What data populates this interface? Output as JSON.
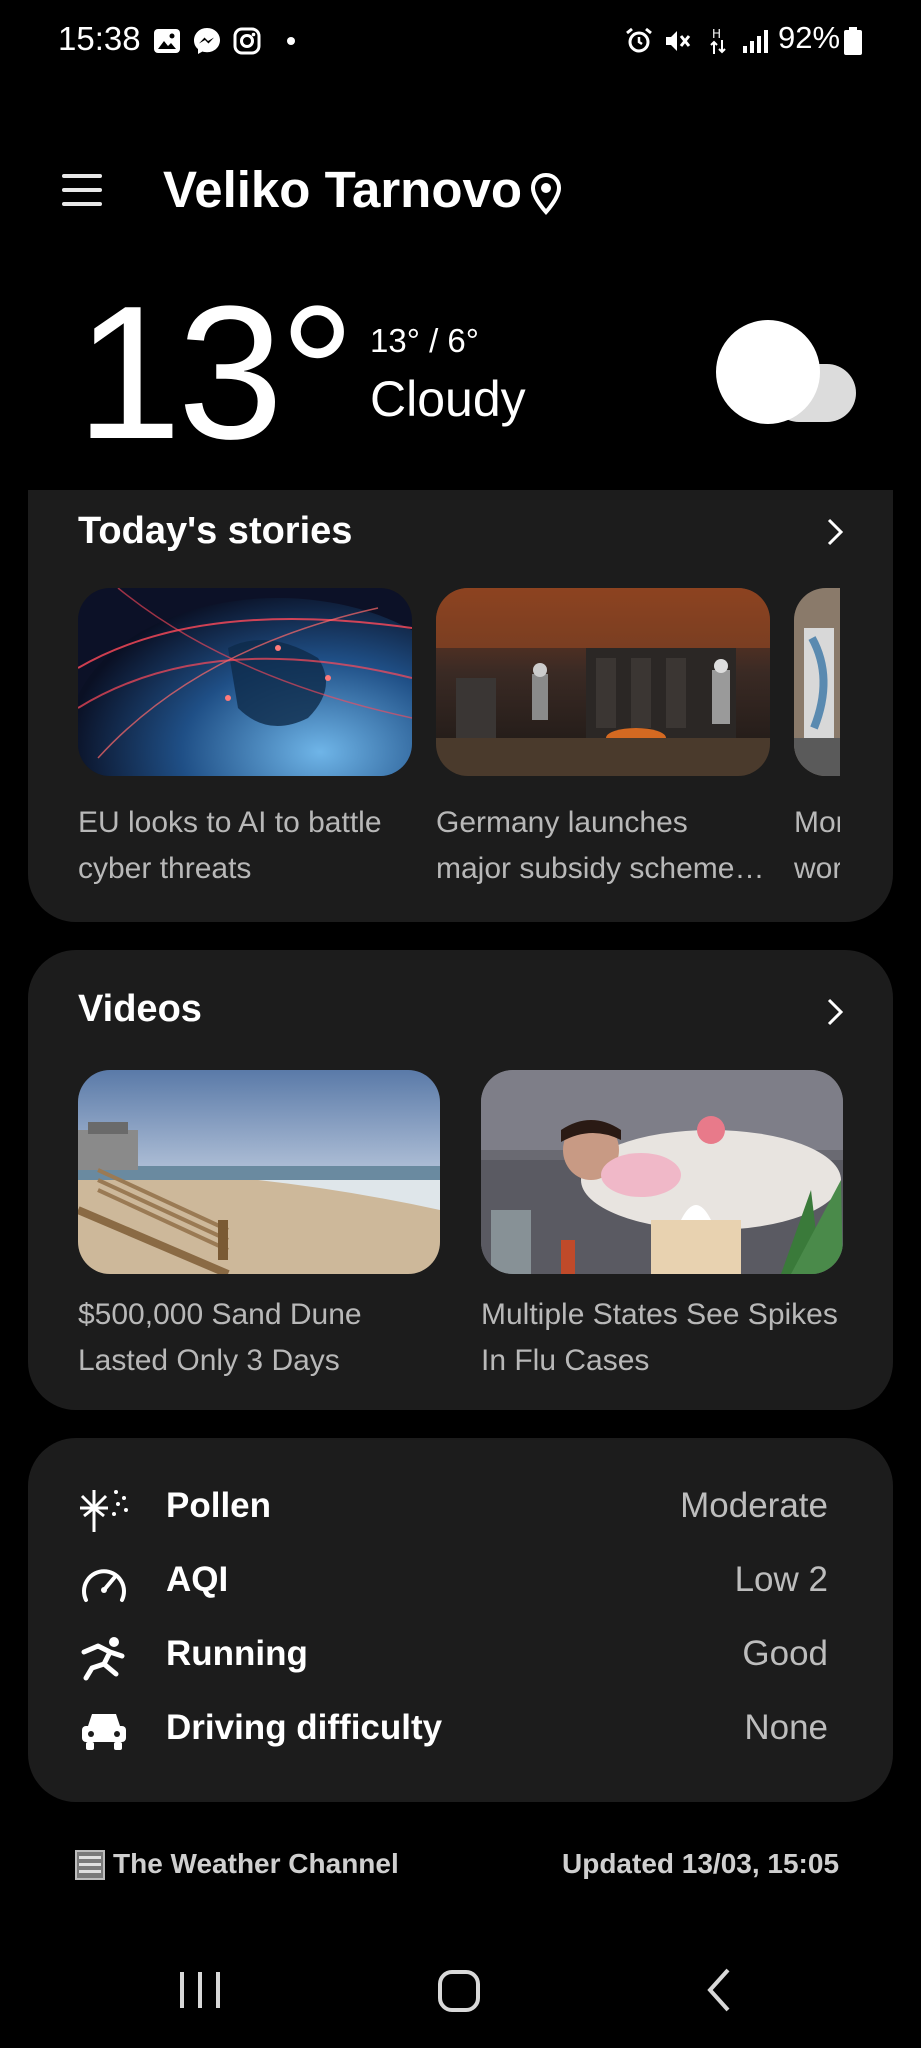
{
  "status_bar": {
    "time": "15:38",
    "left_icons": [
      "gallery-icon",
      "messenger-icon",
      "instagram-icon",
      "dot-icon"
    ],
    "right_icons": [
      "alarm-icon",
      "mute-icon",
      "data-h-icon",
      "signal-icon",
      "battery-icon"
    ],
    "battery": "92%"
  },
  "header": {
    "location": "Veliko Tarnovo",
    "menu_icon": "menu-icon",
    "pin_icon": "location-pin-icon"
  },
  "current": {
    "temperature": "13°",
    "hi_lo": "13° / 6°",
    "condition": "Cloudy",
    "icon": "cloud-icon"
  },
  "stories": {
    "title": "Today's stories",
    "items": [
      {
        "line1": "EU looks to AI to battle",
        "line2": "cyber threats"
      },
      {
        "line1": "Germany launches",
        "line2": "major subsidy scheme…"
      },
      {
        "line1": "Mor",
        "line2": "wor"
      }
    ]
  },
  "videos": {
    "title": "Videos",
    "items": [
      {
        "line1": "$500,000 Sand Dune",
        "line2": "Lasted Only 3 Days"
      },
      {
        "line1": "Multiple States See Spikes",
        "line2": "In Flu Cases"
      }
    ]
  },
  "details": [
    {
      "label": "Pollen",
      "value": "Moderate",
      "icon": "pollen-icon"
    },
    {
      "label": "AQI",
      "value": "Low 2",
      "icon": "gauge-icon"
    },
    {
      "label": "Running",
      "value": "Good",
      "icon": "running-icon"
    },
    {
      "label": "Driving difficulty",
      "value": "None",
      "icon": "car-icon"
    }
  ],
  "footer": {
    "provider": "The Weather Channel",
    "updated": "Updated 13/03, 15:05"
  },
  "nav": {
    "icons": [
      "recent-apps-icon",
      "home-icon",
      "back-icon"
    ]
  }
}
